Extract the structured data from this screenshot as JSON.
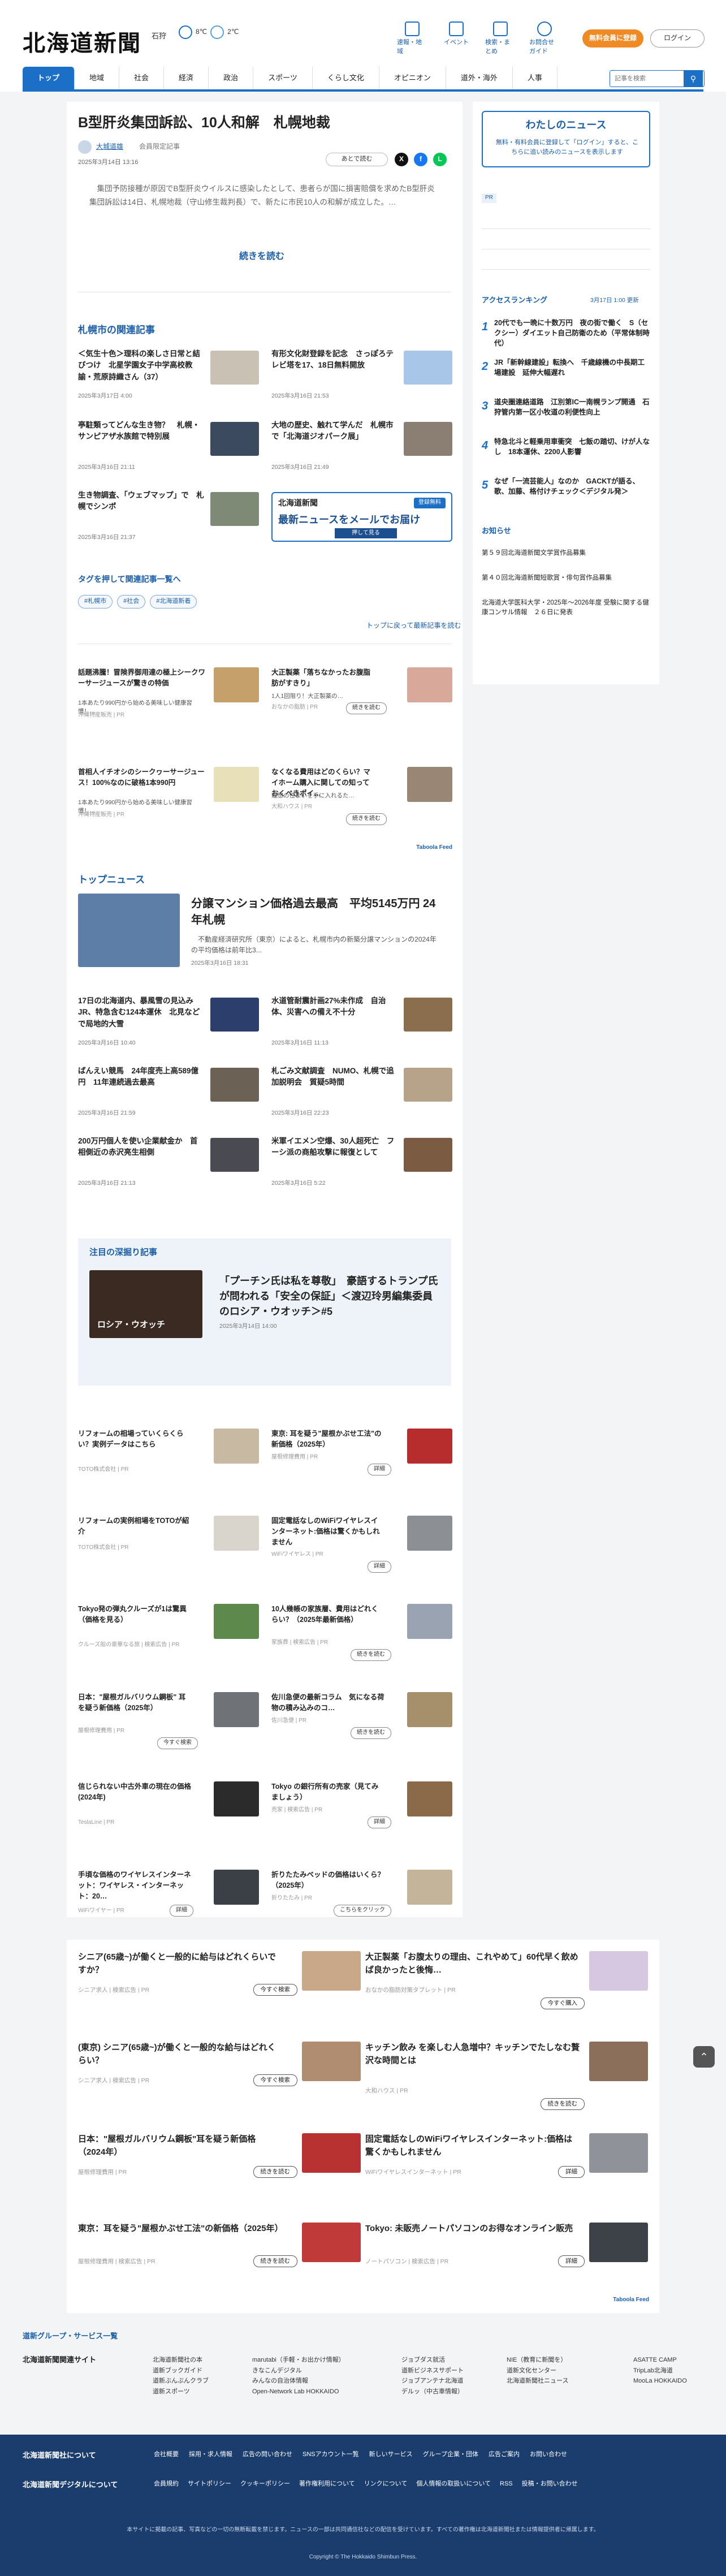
{
  "header": {
    "logo": "北海道新聞",
    "region": "石狩",
    "weather_low": "2℃",
    "weather_high": "8℃",
    "nav_icons": [
      "速報・地域",
      "イベント",
      "検索・まとめ",
      "お問合せガイド"
    ],
    "register": "無料会員に登録",
    "login": "ログイン"
  },
  "nav": {
    "items": [
      "トップ",
      "地域",
      "社会",
      "経済",
      "政治",
      "スポーツ",
      "くらし文化",
      "オピニオン",
      "道外・海外",
      "人事"
    ],
    "search_placeholder": "記事を検索"
  },
  "article": {
    "title": "B型肝炎集団訴訟、10人和解　札幌地裁",
    "author": "大城道雄",
    "author_note": "会員限定記事",
    "published": "2025年3月14日 13:16",
    "later": "あとで読む",
    "lead": "　集団予防接種が原因でB型肝炎ウイルスに感染したとして、患者らが国に損害賠償を求めたB型肝炎集団訴訟は14日、札幌地裁（守山修生裁判長）で、新たに市民10人の和解が成立した。…",
    "readmore": "続きを読む"
  },
  "related": {
    "heading": "札幌市の関連記事",
    "items": [
      {
        "title": "＜気生十色＞理科の楽しさ日常と結びつけ　北星学園女子中学高校教諭・荒原詩織さん（37）",
        "date": "2025年3月17日 4:00"
      },
      {
        "title": "有形文化財登録を記念　さっぽろテレビ塔を17、18日無料開放",
        "date": "2025年3月16日 21:53"
      },
      {
        "title": "亭駐類ってどんな生き物？　札幌・サンピアザ水族館で特別展",
        "date": "2025年3月16日 21:11"
      },
      {
        "title": "大地の歴史、触れて学んだ　札幌市で「北海道ジオパーク展」",
        "date": "2025年3月16日 21:49"
      },
      {
        "title": "生き物調査、「ウェブマップ」で　札幌でシンポ",
        "date": "2025年3月16日 21:37"
      }
    ],
    "ad": {
      "logo": "北海道新聞",
      "badge": "登録無料",
      "text": "最新ニュースをメールでお届け",
      "button": "押して見る"
    }
  },
  "tags": {
    "heading": "タグを押して関連記事一覧へ",
    "items": [
      "#札幌市",
      "#社会",
      "#北海道新着"
    ],
    "back_to_top": "トップに戻って最新記事を読む"
  },
  "promo1": [
    {
      "title": "話題沸騰！冒険界御用達の極上シークワーサージュースが驚きの特価",
      "sub": "1本あたり990円から始める美味しい健康習慣！…",
      "sponsor": "沖縄特産販売 | PR"
    },
    {
      "title": "大正製薬「落ちなかったお腹脂肪がすきり」",
      "sub": "1人1回限り！大正製薬の…",
      "sponsor": "おなかの脂肪 | PR",
      "button": "続きを読む"
    },
    {
      "title": "首相人イチオシのシークヮーサージュース！100%なのに破格1本990円",
      "sub": "1本あたり990円から始める美味しい健康習慣！…",
      "sponsor": "沖縄特産販売 | PR"
    },
    {
      "title": "なくなる費用はどのくらい？マイホーム購入に関しての知っておくべきポイ…",
      "sub": "理想の住まいを手に入れるた…",
      "sponsor": "大和ハウス | PR",
      "button": "続きを読む"
    }
  ],
  "top_news": {
    "heading": "トップニュース",
    "lead": {
      "title": "分譲マンション価格過去最高　平均5145万円 24年札幌",
      "summary": "　不動産経済研究所（東京）によると、札幌市内の新築分譲マンションの2024年の平均価格は前年比3...",
      "date": "2025年3月16日 18:31"
    },
    "items": [
      {
        "title": "17日の北海道内、暴風雪の見込み　JR、特急含む124本運休　北見などで局地的大雪",
        "date": "2025年3月16日 10:40"
      },
      {
        "title": "水道管耐震計画27%未作成　自治体、災害への備え不十分",
        "date": "2025年3月16日 11:13"
      },
      {
        "title": "ばんえい競馬　24年度売上高589億円　11年連続過去最高",
        "date": "2025年3月16日 21:59"
      },
      {
        "title": "札ごみ文献調査　NUMO、札幌で追加説明会　質疑5時間",
        "date": "2025年3月16日 22:23"
      },
      {
        "title": "200万円個人を使い企業献金か　首相側近の赤沢亮生相側",
        "date": "2025年3月16日 21:13"
      },
      {
        "title": "米軍イエメン空爆、30人超死亡　フーシ派の商船攻撃に報復として",
        "date": "2025年3月16日 5:22"
      }
    ]
  },
  "feature": {
    "heading": "注目の深掘り記事",
    "title": "「プーチン氏は私を尊敬」　豪語するトランプ氏が問われる「安全の保証」＜渡辺玲男編集委員のロシア・ウオッチ＞#5",
    "date": "2025年3月14日 14:00",
    "thumb_text": "ロシア・ウオッチ"
  },
  "promo2": [
    {
      "title": "リフォームの相場っていくらくらい？実例データはこちら",
      "sponsor": "TOTO株式会社 | PR"
    },
    {
      "title": "東京: 耳を疑う\"屋根かぶせ工法\"の新価格（2025年）",
      "sponsor": "屋根修理費用 | PR",
      "button": "詳細"
    },
    {
      "title": "リフォームの実例相場をTOTOが紹介",
      "sponsor": "TOTO株式会社 | PR"
    },
    {
      "title": "固定電話なしのWiFiワイヤレスインターネット:価格は驚くかもしれません",
      "sponsor": "WiFiワイヤレス | PR",
      "button": "詳細"
    },
    {
      "title": "Tokyo発の弾丸クルーズが1は驚異（価格を見る）",
      "sponsor": "クルーズ船の豪華なる旅 | 検索広告 | PR"
    },
    {
      "title": "10人幾帳の家族層、費用はどれくらい？（2025年最新価格）",
      "sponsor": "家族葬 | 検索広告 | PR",
      "button": "続きを読む"
    },
    {
      "title": "日本：\"屋根ガルバリウム鋼板\" 耳を疑う新価格（2025年）",
      "sponsor": "屋根修理費用 | PR",
      "button": "今すぐ検索"
    },
    {
      "title": "佐川急便の最新コラム　気になる荷物の積み込みのコ…",
      "sponsor": "佐川急便 | PR",
      "button": "続きを読む"
    },
    {
      "title": "信じられない中古外車の現在の価格(2024年)",
      "sponsor": "TeslaLine | PR"
    },
    {
      "title": "Tokyo の銀行所有の売家（見てみましょう）",
      "sponsor": "売家 | 検索広告 | PR",
      "button": "詳細"
    },
    {
      "title": "手頃な価格のワイヤレスインターネット：ワイヤレス・インターネット：20…",
      "sponsor": "WiFiワイヤー | PR",
      "button": "詳細"
    },
    {
      "title": "折りたたみベッドの価格はいくら？（2025年）",
      "sponsor": "折りたたみ | PR",
      "button": "こちらをクリック"
    }
  ],
  "sidebar": {
    "my_news": "わたしのニュース",
    "my_news_sub": "無料・有料会員に登録して「ログイン」すると、こちらに追い読みのニュースを表示します",
    "ad_label": "PR",
    "ranking_heading": "アクセスランキング",
    "ranking_date": "3月17日 1:00 更新",
    "ranking": [
      "20代でも一晩に十数万円　夜の街で働く　S（セクシー）ダイエット自己防衛のため（平常体制時代）",
      "JR「新幹線建設」転換へ　千歳線機の中長期工場建設　延伸大幅遅れ",
      "道央圏連絡道路　江別第IC一南幌ランプ開通　石狩管内第一区小牧道の利便性向上",
      "特急北斗と軽乗用車衝突　七飯の踏切、けが人なし　18本運休、2200人影響",
      "なぜ「一流芸能人」なのか　GACKTが語る、歌、加藤、格付けチェック＜デジタル発＞"
    ],
    "notice_heading": "お知らせ",
    "notices": [
      "第５９回北海道新聞文学賞作品募集",
      "第４０回北海道新聞短歌賞・俳句賞作品募集",
      "北海道大学医科大学・2025年〜2026年度 受験に関する健康コンサル情報　２６日に発表"
    ]
  },
  "bottom": [
    {
      "title": "シニア(65歳~)が働くと一般的に給与はどれくらいですか？",
      "sponsor": "シニア求人 | 検索広告 | PR",
      "button": "今すぐ検索"
    },
    {
      "title": "大正製薬「お腹太りの理由、これやめて」60代早く飲めば良かったと後悔…",
      "sponsor": "おなかの脂肪対策タブレット | PR",
      "button": "今すぐ購入"
    },
    {
      "title": "(東京) シニア(65歳~)が働くと一般的な給与はどれくらい？",
      "sponsor": "シニア求人 | 検索広告 | PR",
      "button": "今すぐ検索"
    },
    {
      "title": "キッチン飲み を楽しむ人急増中？キッチンでたしなむ贅沢な時間とは",
      "sponsor": "大和ハウス | PR",
      "button": "続きを読む"
    },
    {
      "title": "日本：\"屋根ガルバリウム鋼板\"耳を疑う新価格（2024年）",
      "sponsor": "屋根修理費用 | PR",
      "button": "続きを読む"
    },
    {
      "title": "固定電話なしのWiFiワイヤレスインターネット:価格は驚くかもしれません",
      "sponsor": "WiFiワイヤレスインターネット | PR",
      "button": "詳細"
    },
    {
      "title": "東京：耳を疑う\"屋根かぶせ工法\"の新価格（2025年）",
      "sponsor": "屋根修理費用 | 検索広告 | PR",
      "button": "続きを読む"
    },
    {
      "title": "Tokyo: 未販売ノートパソコンのお得なオンライン販売",
      "sponsor": "ノートパソコン | 検索広告 | PR",
      "button": "詳細"
    }
  ],
  "taboola": "Taboola Feed",
  "group": {
    "heading": "道新グループ・サービス一覧",
    "sites_heading": "北海道新聞関連サイト",
    "sites": [
      [
        "北海道新聞社の本",
        "道新ブックガイド",
        "道新ぶんぶんクラブ",
        "道新スポーツ"
      ],
      [
        "marutabi（手軽・お出かけ情報）",
        "きなこんデジタル",
        "みんなの自治体情報",
        "Open-Network Lab HOKKAIDO"
      ],
      [
        "ジョブダス就活",
        "道新ビジネスサポート",
        "ジョブアンテナ北海道",
        "デルッ（中古車情報）"
      ],
      [
        "NIE（教育に新聞を）",
        "道新文化センター",
        "北海道新聞社ニュース"
      ],
      [
        "ASATTE CAMP",
        "TripLab北海道",
        "MooLa HOKKAIDO"
      ]
    ]
  },
  "footer": {
    "h1": "北海道新聞社について",
    "h2": "北海道新聞デジタルについて",
    "links1": [
      "会社概要",
      "採用・求人情報",
      "広告の問い合わせ",
      "SNSアカウント一覧",
      "新しいサービス",
      "グループ企業・団体",
      "広告ご案内",
      "お問い合わせ"
    ],
    "links2": [
      "会員規約",
      "サイトポリシー",
      "クッキーポリシー",
      "著作権利用について",
      "リンクについて",
      "個人情報の取扱いについて",
      "RSS",
      "投稿・お問い合わせ"
    ],
    "note": "本サイトに掲載の記事、写真などの一切の無断転載を禁じます。ニュースの一部は共同通信社などの配信を受けています。すべての著作権は北海道新聞社または情報提供者に帰属します。",
    "copyright": "Copyright © The Hokkaido Shimbun Press."
  }
}
